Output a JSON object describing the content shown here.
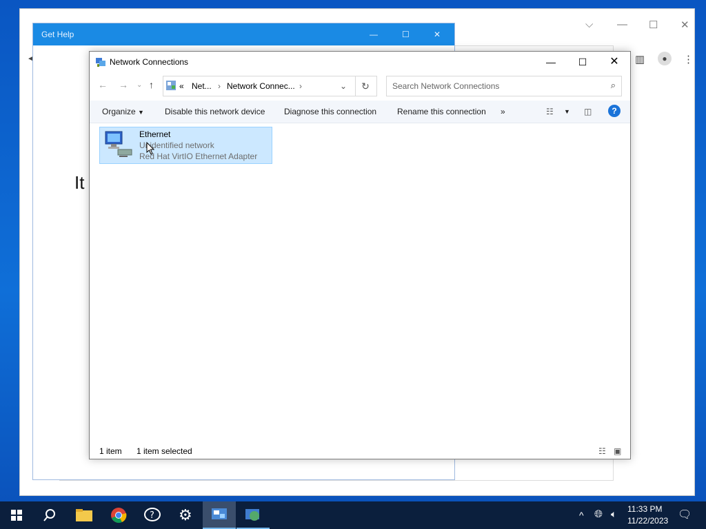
{
  "browser": {
    "title": "",
    "buttons": [
      "chevron",
      "minimize",
      "maximize",
      "close"
    ]
  },
  "get_help": {
    "title": "Get Help",
    "big_text": "It"
  },
  "explorer": {
    "title": "Network Connections",
    "breadcrumb": {
      "overflow": "«",
      "part1": "Net...",
      "part2": "Network Connec..."
    },
    "search_placeholder": "Search Network Connections",
    "commands": {
      "organize": "Organize",
      "disable": "Disable this network device",
      "diagnose": "Diagnose this connection",
      "rename": "Rename this connection",
      "more": "»"
    },
    "items": [
      {
        "name": "Ethernet",
        "status": "Unidentified network",
        "adapter": "Red Hat VirtIO Ethernet Adapter"
      }
    ],
    "status_bar": {
      "count": "1 item",
      "selected": "1 item selected"
    }
  },
  "taskbar": {
    "clock": {
      "time": "11:33 PM",
      "date": "11/22/2023"
    }
  },
  "colors": {
    "accent": "#1a8ae4",
    "selection": "#cce8ff",
    "taskbar": "#0b1f3d"
  }
}
